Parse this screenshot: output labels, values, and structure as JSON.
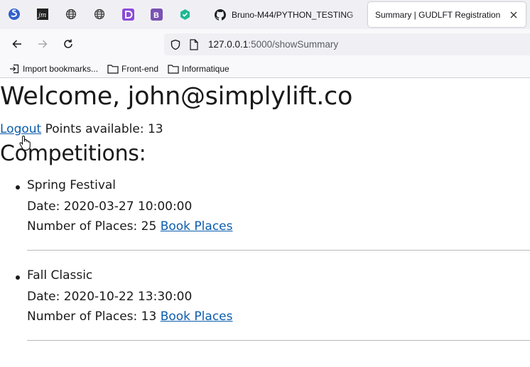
{
  "browser": {
    "pinned_tabs": [
      {
        "icon": "simplenote-icon",
        "color": "#3361cc"
      },
      {
        "icon": "jm-icon",
        "color": "#222222"
      },
      {
        "icon": "globe-icon",
        "color": "#3a3a3a"
      },
      {
        "icon": "globe-icon",
        "color": "#3a3a3a"
      },
      {
        "icon": "d-app-icon",
        "color": "#8c4bd6"
      },
      {
        "icon": "bootstrap-icon",
        "color": "#7952b3"
      },
      {
        "icon": "hexagon-app-icon",
        "color": "#1fb993"
      }
    ],
    "tabs": [
      {
        "title": "Bruno-M44/PYTHON_TESTING",
        "icon": "github-icon",
        "active": false
      },
      {
        "title": "Summary | GUDLFT Registration",
        "active": true
      }
    ],
    "url": {
      "host": "127.0.0.1",
      "rest": ":5000/showSummary"
    },
    "bookmarks": [
      {
        "label": "Import bookmarks...",
        "icon": "import-icon"
      },
      {
        "label": "Front-end",
        "icon": "folder-icon"
      },
      {
        "label": "Informatique",
        "icon": "folder-icon"
      }
    ]
  },
  "page": {
    "welcome": "Welcome, john@simplylift.co",
    "logout_label": "Logout",
    "points_text": "Points available: 13",
    "competitions_heading": "Competitions:",
    "competitions": [
      {
        "name": "Spring Festival",
        "date": "Date: 2020-03-27 10:00:00",
        "places_text": "Number of Places: 25",
        "book_label": "Book Places"
      },
      {
        "name": "Fall Classic",
        "date": "Date: 2020-10-22 13:30:00",
        "places_text": "Number of Places: 13",
        "book_label": "Book Places"
      }
    ]
  },
  "colors": {
    "link": "#0b5cad",
    "tabstrip": "#f0f0f4",
    "toolbar": "#f9f9fb"
  }
}
